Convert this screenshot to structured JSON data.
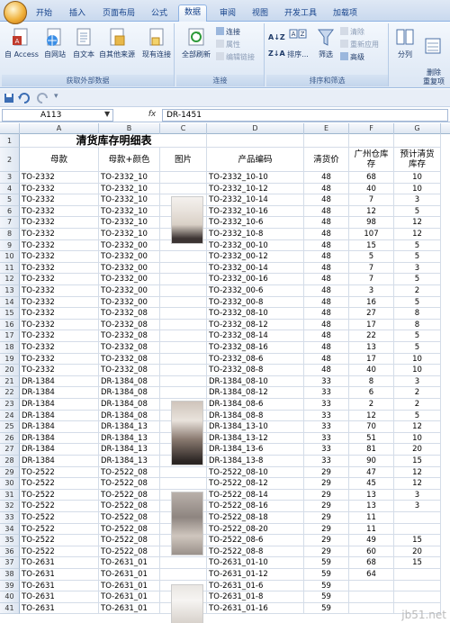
{
  "tabs": [
    "开始",
    "插入",
    "页面布局",
    "公式",
    "数据",
    "审阅",
    "视图",
    "开发工具",
    "加载项"
  ],
  "active_tab": "数据",
  "ribbon": {
    "external": {
      "label": "获取外部数据",
      "buttons": [
        "自 Access",
        "自网站",
        "自文本",
        "自其他来源",
        "现有连接"
      ]
    },
    "connections": {
      "label": "连接",
      "refresh": "全部刷新",
      "items": [
        "连接",
        "属性",
        "编辑链接"
      ]
    },
    "sort": {
      "label": "排序和筛选",
      "sort": "排序...",
      "filter": "筛选",
      "items": [
        "清除",
        "重新应用",
        "高级"
      ]
    },
    "tools": {
      "buttons": [
        "分列",
        "删除\n重复项"
      ]
    }
  },
  "formula_bar": {
    "name_box": "A113",
    "fx": "fx",
    "value": "DR-1451"
  },
  "columns": [
    "A",
    "B",
    "C",
    "D",
    "E",
    "F",
    "G"
  ],
  "sheet": {
    "title": "清货库存明细表",
    "headers": [
      "母款",
      "母款+颜色",
      "图片",
      "产品编码",
      "清货价",
      "广州仓库存",
      "预计清货库存"
    ],
    "rows": [
      [
        "TO-2332",
        "TO-2332_10",
        "",
        "TO-2332_10-10",
        "48",
        "68",
        "10"
      ],
      [
        "TO-2332",
        "TO-2332_10",
        "",
        "TO-2332_10-12",
        "48",
        "40",
        "10"
      ],
      [
        "TO-2332",
        "TO-2332_10",
        "",
        "TO-2332_10-14",
        "48",
        "7",
        "3"
      ],
      [
        "TO-2332",
        "TO-2332_10",
        "",
        "TO-2332_10-16",
        "48",
        "12",
        "5"
      ],
      [
        "TO-2332",
        "TO-2332_10",
        "",
        "TO-2332_10-6",
        "48",
        "98",
        "12"
      ],
      [
        "TO-2332",
        "TO-2332_10",
        "",
        "TO-2332_10-8",
        "48",
        "107",
        "12"
      ],
      [
        "TO-2332",
        "TO-2332_00",
        "",
        "TO-2332_00-10",
        "48",
        "15",
        "5"
      ],
      [
        "TO-2332",
        "TO-2332_00",
        "",
        "TO-2332_00-12",
        "48",
        "5",
        "5"
      ],
      [
        "TO-2332",
        "TO-2332_00",
        "",
        "TO-2332_00-14",
        "48",
        "7",
        "3"
      ],
      [
        "TO-2332",
        "TO-2332_00",
        "",
        "TO-2332_00-16",
        "48",
        "7",
        "5"
      ],
      [
        "TO-2332",
        "TO-2332_00",
        "",
        "TO-2332_00-6",
        "48",
        "3",
        "2"
      ],
      [
        "TO-2332",
        "TO-2332_00",
        "",
        "TO-2332_00-8",
        "48",
        "16",
        "5"
      ],
      [
        "TO-2332",
        "TO-2332_08",
        "",
        "TO-2332_08-10",
        "48",
        "27",
        "8"
      ],
      [
        "TO-2332",
        "TO-2332_08",
        "",
        "TO-2332_08-12",
        "48",
        "17",
        "8"
      ],
      [
        "TO-2332",
        "TO-2332_08",
        "",
        "TO-2332_08-14",
        "48",
        "22",
        "5"
      ],
      [
        "TO-2332",
        "TO-2332_08",
        "",
        "TO-2332_08-16",
        "48",
        "13",
        "5"
      ],
      [
        "TO-2332",
        "TO-2332_08",
        "",
        "TO-2332_08-6",
        "48",
        "17",
        "10"
      ],
      [
        "TO-2332",
        "TO-2332_08",
        "",
        "TO-2332_08-8",
        "48",
        "40",
        "10"
      ],
      [
        "DR-1384",
        "DR-1384_08",
        "",
        "DR-1384_08-10",
        "33",
        "8",
        "3"
      ],
      [
        "DR-1384",
        "DR-1384_08",
        "",
        "DR-1384_08-12",
        "33",
        "6",
        "2"
      ],
      [
        "DR-1384",
        "DR-1384_08",
        "",
        "DR-1384_08-6",
        "33",
        "2",
        "2"
      ],
      [
        "DR-1384",
        "DR-1384_08",
        "",
        "DR-1384_08-8",
        "33",
        "12",
        "5"
      ],
      [
        "DR-1384",
        "DR-1384_13",
        "",
        "DR-1384_13-10",
        "33",
        "70",
        "12"
      ],
      [
        "DR-1384",
        "DR-1384_13",
        "",
        "DR-1384_13-12",
        "33",
        "51",
        "10"
      ],
      [
        "DR-1384",
        "DR-1384_13",
        "",
        "DR-1384_13-6",
        "33",
        "81",
        "20"
      ],
      [
        "DR-1384",
        "DR-1384_13",
        "",
        "DR-1384_13-8",
        "33",
        "90",
        "15"
      ],
      [
        "TO-2522",
        "TO-2522_08",
        "",
        "TO-2522_08-10",
        "29",
        "47",
        "12"
      ],
      [
        "TO-2522",
        "TO-2522_08",
        "",
        "TO-2522_08-12",
        "29",
        "45",
        "12"
      ],
      [
        "TO-2522",
        "TO-2522_08",
        "",
        "TO-2522_08-14",
        "29",
        "13",
        "3"
      ],
      [
        "TO-2522",
        "TO-2522_08",
        "",
        "TO-2522_08-16",
        "29",
        "13",
        "3"
      ],
      [
        "TO-2522",
        "TO-2522_08",
        "",
        "TO-2522_08-18",
        "29",
        "11",
        ""
      ],
      [
        "TO-2522",
        "TO-2522_08",
        "",
        "TO-2522_08-20",
        "29",
        "11",
        ""
      ],
      [
        "TO-2522",
        "TO-2522_08",
        "",
        "TO-2522_08-6",
        "29",
        "49",
        "15"
      ],
      [
        "TO-2522",
        "TO-2522_08",
        "",
        "TO-2522_08-8",
        "29",
        "60",
        "20"
      ],
      [
        "TO-2631",
        "TO-2631_01",
        "",
        "TO-2631_01-10",
        "59",
        "68",
        "15"
      ],
      [
        "TO-2631",
        "TO-2631_01",
        "",
        "TO-2631_01-12",
        "59",
        "64",
        ""
      ],
      [
        "TO-2631",
        "TO-2631_01",
        "",
        "TO-2631_01-6",
        "59",
        "",
        ""
      ],
      [
        "TO-2631",
        "TO-2631_01",
        "",
        "TO-2631_01-8",
        "59",
        "",
        ""
      ],
      [
        "TO-2631",
        "TO-2631_01",
        "",
        "TO-2631_01-16",
        "59",
        "",
        ""
      ]
    ]
  },
  "watermark": "jb51.net"
}
